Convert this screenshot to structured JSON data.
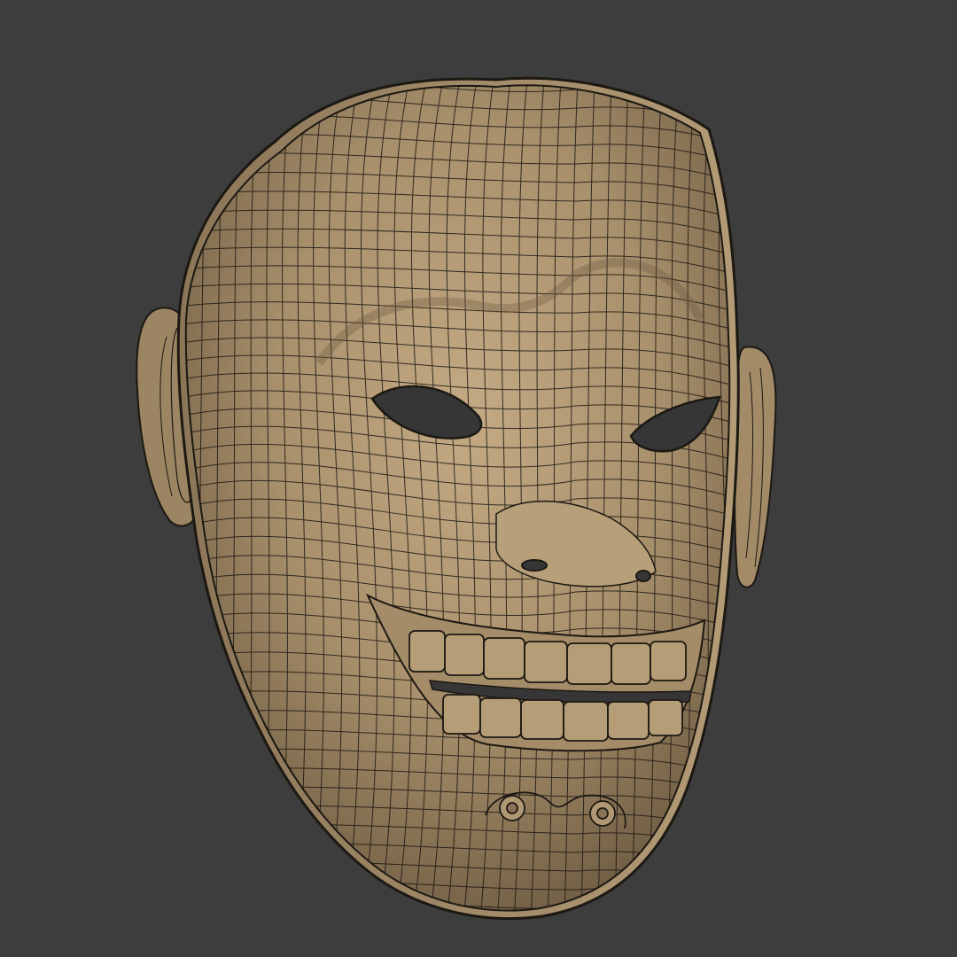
{
  "viewport": {
    "background": "#3d3d3d"
  },
  "model": {
    "subject": "wireframe-mask",
    "material_color": "#a8906c",
    "material_shadow": "#6d5a41",
    "material_highlight": "#c9b18c",
    "wire_color": "#1c1812",
    "hole_color": "#363636"
  }
}
